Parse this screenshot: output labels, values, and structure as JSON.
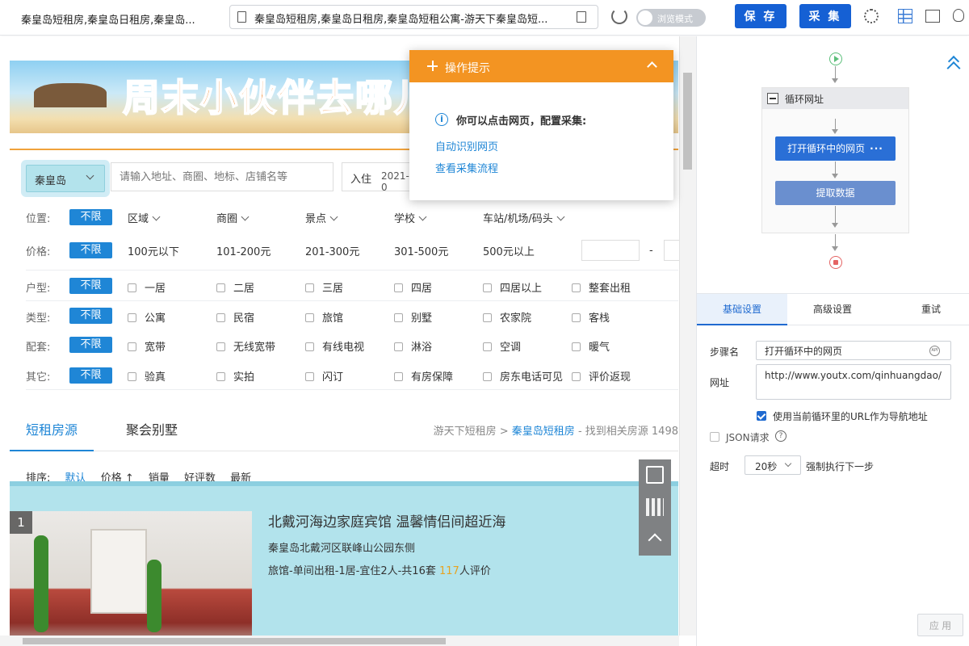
{
  "topbar": {
    "tab_title": "秦皇岛短租房,秦皇岛日租房,秦皇岛...",
    "url": "秦皇岛短租房,秦皇岛日租房,秦皇岛短租公寓-游天下秦皇岛短...",
    "browse_mode_label": "浏览模式",
    "save_label": "保 存",
    "collect_label": "采 集"
  },
  "page": {
    "banner_text": "周末小伙伴去哪儿",
    "city": "秦皇岛",
    "search_placeholder": "请输入地址、商圈、地标、店铺名等",
    "checkin_label": "入住",
    "checkin_value": "2021-0",
    "filters": {
      "location": {
        "label": "位置:",
        "badge": "不限",
        "options": [
          "区域",
          "商圈",
          "景点",
          "学校",
          "车站/机场/码头"
        ]
      },
      "price": {
        "label": "价格:",
        "badge": "不限",
        "options": [
          "100元以下",
          "101-200元",
          "201-300元",
          "301-500元",
          "500元以上"
        ],
        "dash": "-"
      },
      "room": {
        "label": "户型:",
        "badge": "不限",
        "options": [
          "一居",
          "二居",
          "三居",
          "四居",
          "四居以上",
          "整套出租"
        ]
      },
      "type": {
        "label": "类型:",
        "badge": "不限",
        "options": [
          "公寓",
          "民宿",
          "旅馆",
          "别墅",
          "农家院",
          "客栈"
        ]
      },
      "facility": {
        "label": "配套:",
        "badge": "不限",
        "options": [
          "宽带",
          "无线宽带",
          "有线电视",
          "淋浴",
          "空调",
          "暖气"
        ]
      },
      "other": {
        "label": "其它:",
        "badge": "不限",
        "options": [
          "验真",
          "实拍",
          "闪订",
          "有房保障",
          "房东电话可见",
          "评价返现"
        ]
      }
    },
    "tabs": [
      "短租房源",
      "聚会别墅"
    ],
    "crumbs": {
      "site": "游天下短租房",
      "sep": ">",
      "city_link": "秦皇岛短租房",
      "found": "- 找到相关房源 1498"
    },
    "sort": {
      "label": "排序:",
      "items": [
        "默认",
        "价格 ↑",
        "销量",
        "好评数",
        "最新"
      ]
    },
    "listing": {
      "rank": "1",
      "title": "北戴河海边家庭宾馆 温馨情侣间超近海",
      "address": "秦皇岛北戴河区联峰山公园东侧",
      "meta_prefix": "旅馆-单间出租-1居-宜住2人-共16套 ",
      "reviews": "117",
      "meta_suffix": "人评价"
    }
  },
  "tip_popup": {
    "title": "操作提示",
    "message": "你可以点击网页，配置采集:",
    "links": [
      "自动识别网页",
      "查看采集流程"
    ]
  },
  "workflow": {
    "loop_title": "循环网址",
    "open_node": "打开循环中的网页",
    "extract_node": "提取数据"
  },
  "settings": {
    "tabs": [
      "基础设置",
      "高级设置",
      "重试"
    ],
    "step_name_label": "步骤名",
    "step_name_value": "打开循环中的网页",
    "url_label": "网址",
    "url_value": "http://www.youtx.com/qinhuangdao/",
    "use_loop_url_label": "使用当前循环里的URL作为导航地址",
    "json_label": "JSON请求",
    "timeout_label": "超时",
    "timeout_value": "20秒",
    "timeout_after": "强制执行下一步",
    "apply_label": "应 用"
  },
  "colors": {
    "accent": "#1560d4",
    "orange": "#f39422",
    "link": "#1f86d6"
  }
}
